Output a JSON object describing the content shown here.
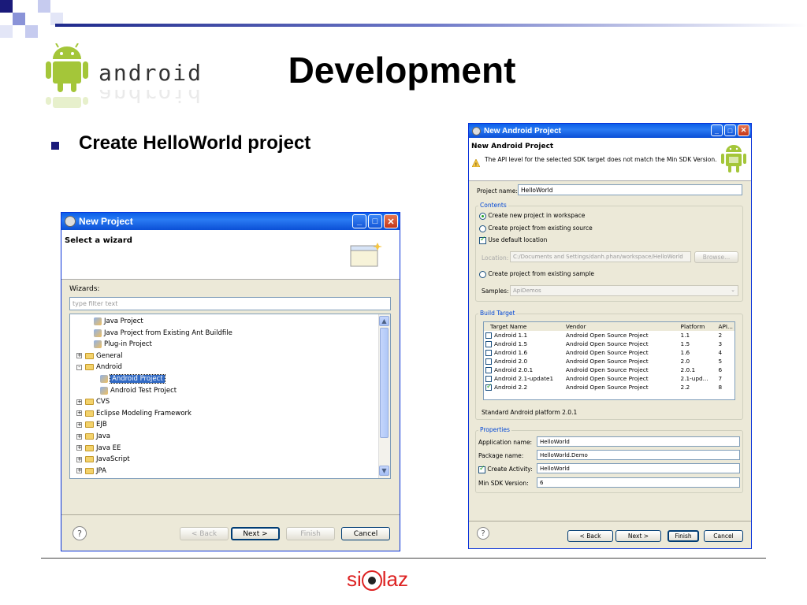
{
  "slide": {
    "title": "Development",
    "bullet": "Create HelloWorld project",
    "android_wordmark": "android",
    "footer_logo": {
      "left": "si",
      "right": "laz"
    }
  },
  "new_project": {
    "window_title": "New Project",
    "heading": "Select a wizard",
    "wizards_label": "Wizards:",
    "filter_placeholder": "type filter text",
    "tree": [
      {
        "label": "Java Project",
        "indent": 1
      },
      {
        "label": "Java Project from Existing Ant Buildfile",
        "indent": 1
      },
      {
        "label": "Plug-in Project",
        "indent": 1
      },
      {
        "label": "General",
        "indent": 0,
        "folder": true,
        "expander": "+"
      },
      {
        "label": "Android",
        "indent": 0,
        "folder": true,
        "expander": "−"
      },
      {
        "label": "Android Project",
        "indent": 2,
        "selected": true
      },
      {
        "label": "Android Test Project",
        "indent": 2
      },
      {
        "label": "CVS",
        "indent": 0,
        "folder": true,
        "expander": "+"
      },
      {
        "label": "Eclipse Modeling Framework",
        "indent": 0,
        "folder": true,
        "expander": "+"
      },
      {
        "label": "EJB",
        "indent": 0,
        "folder": true,
        "expander": "+"
      },
      {
        "label": "Java",
        "indent": 0,
        "folder": true,
        "expander": "+"
      },
      {
        "label": "Java EE",
        "indent": 0,
        "folder": true,
        "expander": "+"
      },
      {
        "label": "JavaScript",
        "indent": 0,
        "folder": true,
        "expander": "+"
      },
      {
        "label": "JPA",
        "indent": 0,
        "folder": true,
        "expander": "+"
      }
    ],
    "buttons": {
      "back": "< Back",
      "next": "Next >",
      "finish": "Finish",
      "cancel": "Cancel"
    },
    "help": "?"
  },
  "android_project": {
    "window_title": "New Android Project",
    "heading": "New Android Project",
    "warning": "The API level for the selected SDK target does not match the Min SDK Version.",
    "project_name_label": "Project name:",
    "project_name_value": "HelloWorld",
    "contents_label": "Contents",
    "opt_new": "Create new project in workspace",
    "opt_existing": "Create project from existing source",
    "use_default": "Use default location",
    "location_label": "Location:",
    "location_value": "C:/Documents and Settings/danh.phan/workspace/HelloWorld",
    "browse": "Browse...",
    "opt_sample": "Create project from existing sample",
    "samples_label": "Samples:",
    "samples_value": "ApiDemos",
    "build_target_label": "Build Target",
    "columns": [
      "Target Name",
      "Vendor",
      "Platform",
      "API..."
    ],
    "targets": [
      {
        "name": "Android 1.1",
        "vendor": "Android Open Source Project",
        "platform": "1.1",
        "api": "2",
        "checked": false
      },
      {
        "name": "Android 1.5",
        "vendor": "Android Open Source Project",
        "platform": "1.5",
        "api": "3",
        "checked": false
      },
      {
        "name": "Android 1.6",
        "vendor": "Android Open Source Project",
        "platform": "1.6",
        "api": "4",
        "checked": false
      },
      {
        "name": "Android 2.0",
        "vendor": "Android Open Source Project",
        "platform": "2.0",
        "api": "5",
        "checked": false
      },
      {
        "name": "Android 2.0.1",
        "vendor": "Android Open Source Project",
        "platform": "2.0.1",
        "api": "6",
        "checked": false
      },
      {
        "name": "Android 2.1-update1",
        "vendor": "Android Open Source Project",
        "platform": "2.1-upd...",
        "api": "7",
        "checked": false
      },
      {
        "name": "Android 2.2",
        "vendor": "Android Open Source Project",
        "platform": "2.2",
        "api": "8",
        "checked": true
      }
    ],
    "platform_note": "Standard Android platform 2.0.1",
    "properties_label": "Properties",
    "app_name_label": "Application name:",
    "app_name_value": "HelloWorld",
    "package_label": "Package name:",
    "package_value": "HelloWorld.Demo",
    "create_activity_label": "Create Activity:",
    "create_activity_value": "HelloWorld",
    "min_sdk_label": "Min SDK Version:",
    "min_sdk_value": "6",
    "buttons": {
      "back": "< Back",
      "next": "Next >",
      "finish": "Finish",
      "cancel": "Cancel"
    },
    "help": "?"
  },
  "colors": {
    "accent": "#0a5ee8",
    "android_green": "#a4c639",
    "slide_navy": "#1f2a8c"
  }
}
